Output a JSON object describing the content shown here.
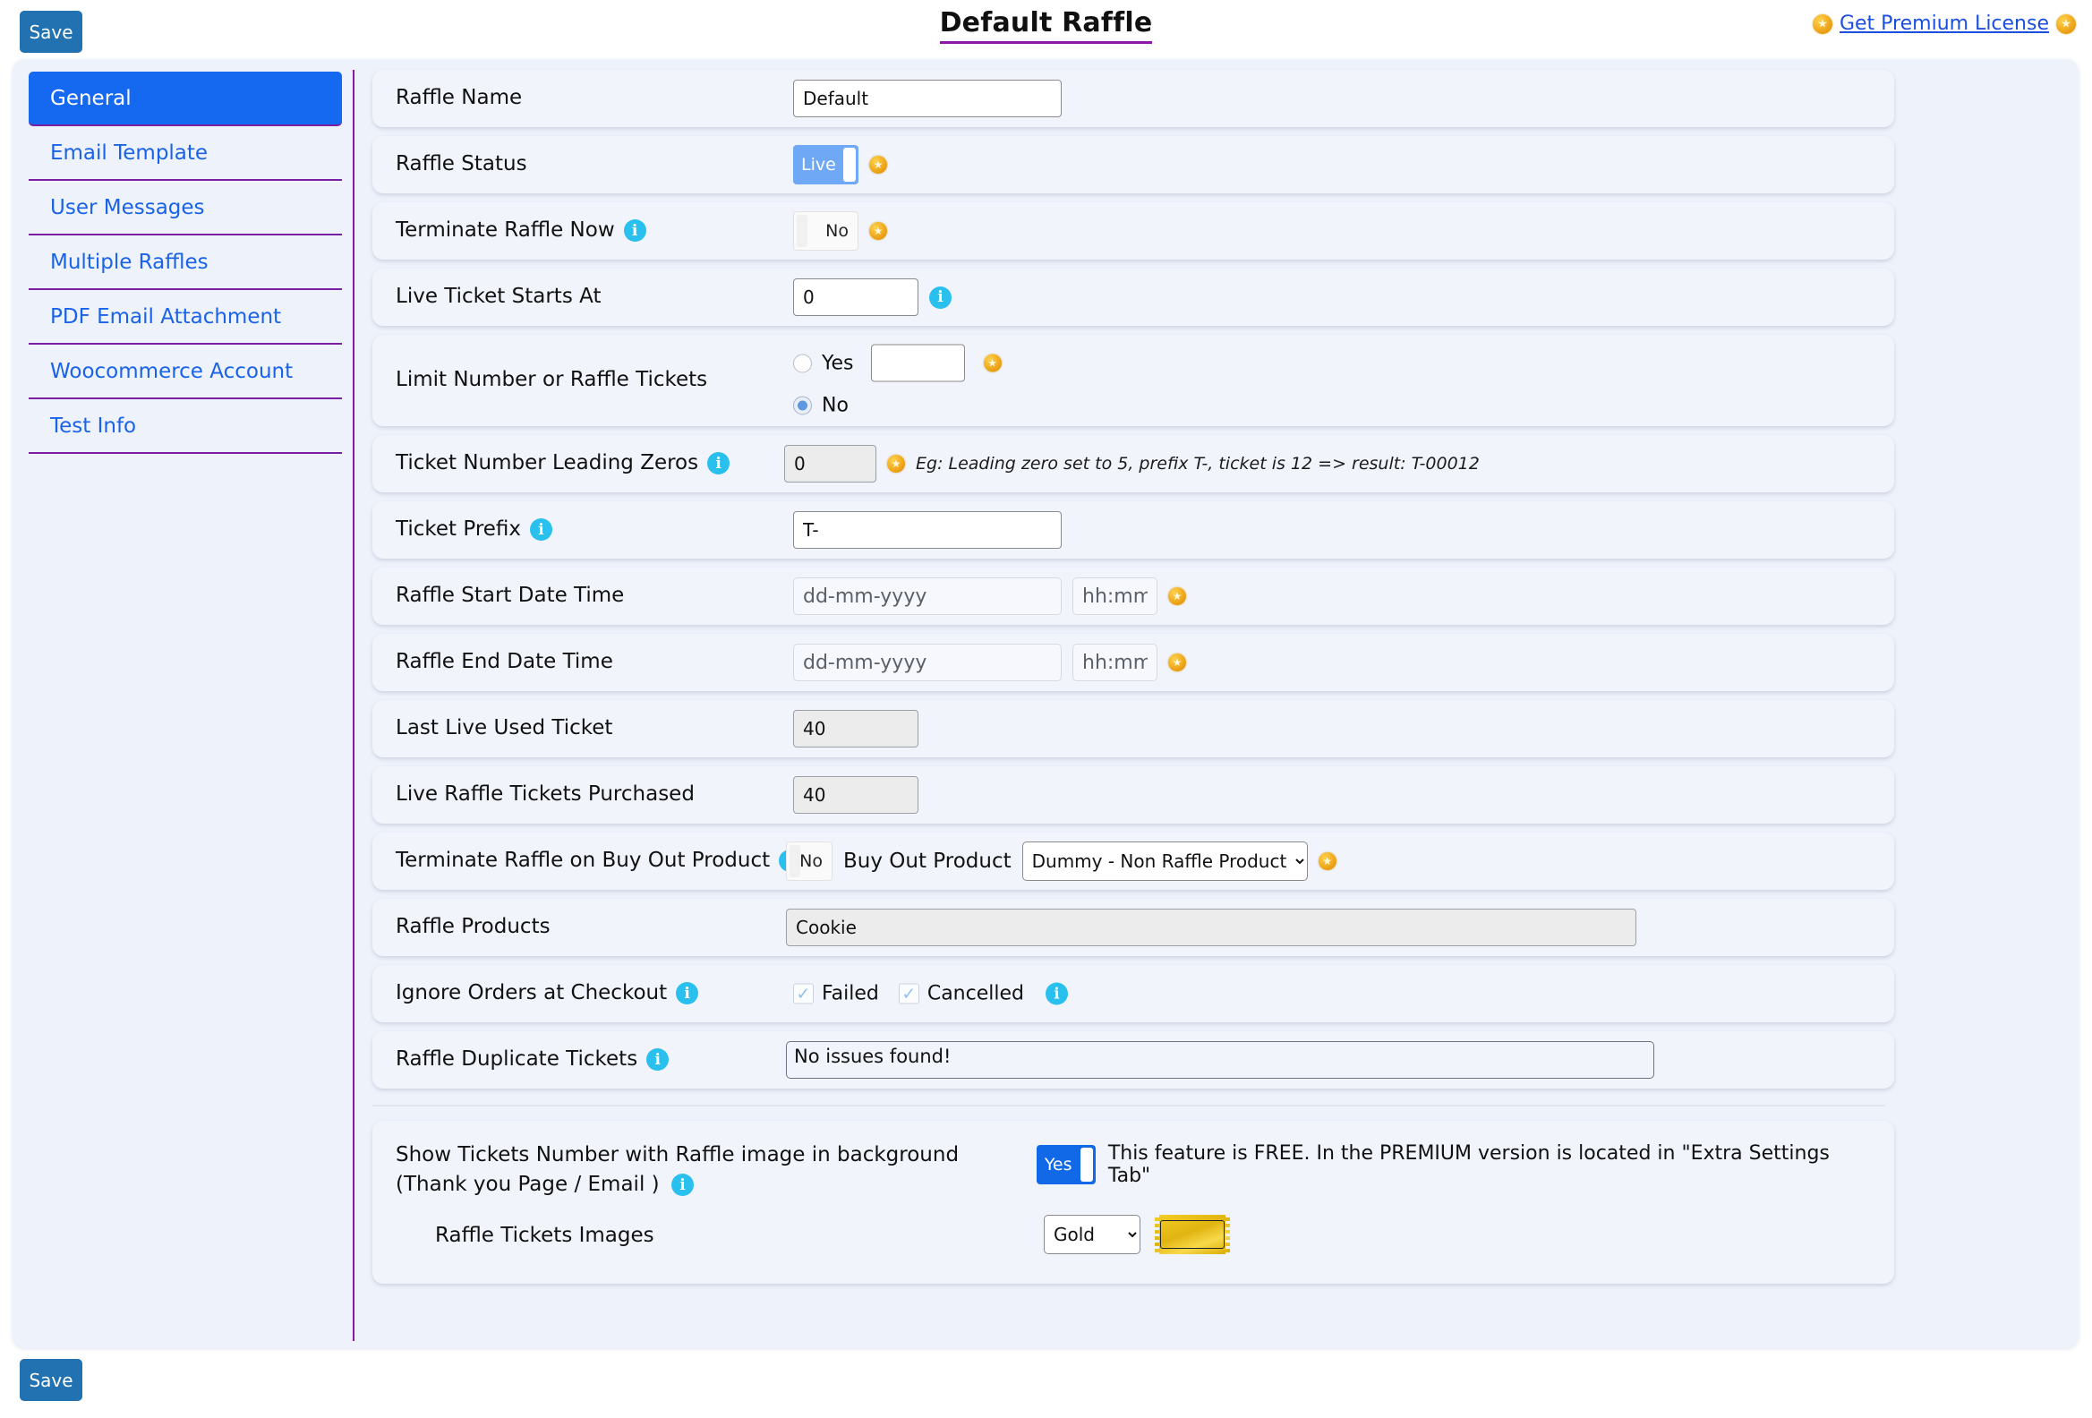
{
  "header": {
    "save_label": "Save",
    "title": "Default Raffle",
    "premium_link": "Get Premium License",
    "left_coin_icon": "gold-star-coin-icon",
    "right_coin_icon": "gold-star-coin-icon"
  },
  "sidebar": {
    "items": [
      {
        "label": "General",
        "active": true
      },
      {
        "label": "Email Template",
        "active": false
      },
      {
        "label": "User Messages",
        "active": false
      },
      {
        "label": "Multiple Raffles",
        "active": false
      },
      {
        "label": "PDF Email Attachment",
        "active": false
      },
      {
        "label": "Woocommerce Account",
        "active": false
      },
      {
        "label": "Test Info",
        "active": false
      }
    ]
  },
  "form": {
    "raffle_name": {
      "label": "Raffle Name",
      "value": "Default"
    },
    "raffle_status": {
      "label": "Raffle Status",
      "toggle": "Live"
    },
    "terminate_now": {
      "label": "Terminate Raffle Now",
      "toggle": "No"
    },
    "live_ticket_starts": {
      "label": "Live Ticket Starts At",
      "value": "0"
    },
    "limit_tickets": {
      "label": "Limit Number or Raffle Tickets",
      "option_yes": "Yes",
      "option_no": "No",
      "yes_value": "",
      "selected": "No"
    },
    "leading_zeros": {
      "label": "Ticket Number Leading Zeros",
      "value": "0",
      "example": "Eg: Leading zero set to 5, prefix T-, ticket is 12 => result: T-00012"
    },
    "ticket_prefix": {
      "label": "Ticket Prefix",
      "value": "T-"
    },
    "start_datetime": {
      "label": "Raffle Start Date Time",
      "date_placeholder": "dd-mm-yyyy",
      "time_placeholder": "hh:mm",
      "date_value": "",
      "time_value": ""
    },
    "end_datetime": {
      "label": "Raffle End Date Time",
      "date_placeholder": "dd-mm-yyyy",
      "time_placeholder": "hh:mm",
      "date_value": "",
      "time_value": ""
    },
    "last_live_ticket": {
      "label": "Last Live Used Ticket",
      "value": "40"
    },
    "tickets_purchased": {
      "label": "Live Raffle Tickets Purchased",
      "value": "40"
    },
    "buy_out": {
      "label": "Terminate Raffle on Buy Out Product",
      "toggle": "No",
      "inline_label": "Buy Out Product",
      "selected_product": "Dummy - Non Raffle Product"
    },
    "raffle_products": {
      "label": "Raffle Products",
      "value": "Cookie"
    },
    "ignore_orders": {
      "label": "Ignore Orders at Checkout",
      "checkbox_failed": "Failed",
      "checkbox_cancelled": "Cancelled",
      "failed_checked": true,
      "cancelled_checked": true
    },
    "duplicate_tickets": {
      "label": "Raffle Duplicate Tickets",
      "value": "No issues found!"
    }
  },
  "extra": {
    "label": "Show Tickets Number with Raffle image in background (Thank you Page / Email )",
    "toggle": "Yes",
    "note": "This feature is FREE. In the PREMIUM version is located in \"Extra Settings Tab\"",
    "images_label": "Raffle Tickets Images",
    "images_selected": "Gold",
    "ticket_preview_icon": "gold-ticket-icon"
  },
  "footer": {
    "save_label": "Save"
  },
  "colors": {
    "accent_blue": "#1569f0",
    "save_blue": "#2271b1",
    "purple": "#8b18a8",
    "info_cyan": "#29c0ee",
    "gold": "#e0b411",
    "panel_bg": "#eef2fb",
    "row_bg": "#f1f4fb"
  }
}
